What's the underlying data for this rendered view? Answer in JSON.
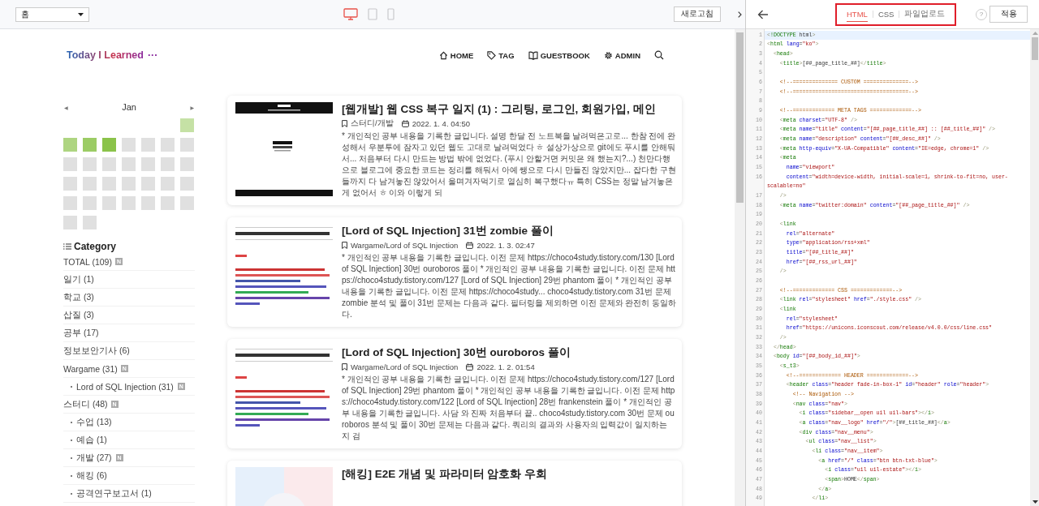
{
  "toolbar": {
    "page_select": "홈",
    "devices": [
      {
        "kind": "desktop",
        "selected": true
      },
      {
        "kind": "tablet",
        "selected": false
      },
      {
        "kind": "mobile",
        "selected": false
      }
    ],
    "refresh_button": "새로고침"
  },
  "blog": {
    "logo": "Today I Learned",
    "logo_more": "···",
    "nav": [
      {
        "kind": "home",
        "label": "HOME"
      },
      {
        "kind": "tag",
        "label": "TAG"
      },
      {
        "kind": "guestbook",
        "label": "GUESTBOOK"
      },
      {
        "kind": "admin",
        "label": "ADMIN"
      },
      {
        "kind": "search"
      }
    ]
  },
  "calendar": {
    "prev": "◀",
    "month": "Jan",
    "next": "▶",
    "days": [
      {
        "kind": "blank"
      },
      {
        "kind": "blank"
      },
      {
        "kind": "blank"
      },
      {
        "kind": "blank"
      },
      {
        "kind": "blank"
      },
      {
        "kind": "blank"
      },
      {
        "kind": "day",
        "color": "#c5e1a5"
      },
      {
        "kind": "day",
        "color": "#aed581"
      },
      {
        "kind": "day",
        "color": "#9ccc65"
      },
      {
        "kind": "day",
        "color": "#8bc34a"
      },
      {
        "kind": "day",
        "color": "#e0e0e0"
      },
      {
        "kind": "day",
        "color": "#e0e0e0"
      },
      {
        "kind": "day",
        "color": "#e0e0e0"
      },
      {
        "kind": "day",
        "color": "#e0e0e0"
      },
      {
        "kind": "day",
        "color": "#e0e0e0"
      },
      {
        "kind": "day",
        "color": "#e0e0e0"
      },
      {
        "kind": "day",
        "color": "#e0e0e0"
      },
      {
        "kind": "day",
        "color": "#e0e0e0"
      },
      {
        "kind": "day",
        "color": "#e0e0e0"
      },
      {
        "kind": "day",
        "color": "#e0e0e0"
      },
      {
        "kind": "day",
        "color": "#e0e0e0"
      },
      {
        "kind": "day",
        "color": "#e0e0e0"
      },
      {
        "kind": "day",
        "color": "#e0e0e0"
      },
      {
        "kind": "day",
        "color": "#e0e0e0"
      },
      {
        "kind": "day",
        "color": "#e0e0e0"
      },
      {
        "kind": "day",
        "color": "#e0e0e0"
      },
      {
        "kind": "day",
        "color": "#e0e0e0"
      },
      {
        "kind": "day",
        "color": "#e0e0e0"
      },
      {
        "kind": "day",
        "color": "#e0e0e0"
      },
      {
        "kind": "day",
        "color": "#e0e0e0"
      },
      {
        "kind": "day",
        "color": "#e0e0e0"
      },
      {
        "kind": "day",
        "color": "#e0e0e0"
      },
      {
        "kind": "day",
        "color": "#e0e0e0"
      },
      {
        "kind": "day",
        "color": "#e0e0e0"
      },
      {
        "kind": "day",
        "color": "#e0e0e0"
      },
      {
        "kind": "day",
        "color": "#e0e0e0"
      },
      {
        "kind": "day",
        "color": "#e0e0e0"
      }
    ]
  },
  "category": {
    "title": "Category",
    "items": [
      {
        "label": "TOTAL (109)",
        "badge": "N"
      },
      {
        "label": "일기 (1)"
      },
      {
        "label": "학교 (3)"
      },
      {
        "label": "삽질 (3)"
      },
      {
        "label": "공부 (17)"
      },
      {
        "label": "정보보안기사 (6)"
      },
      {
        "label": "Wargame (31)",
        "badge": "N",
        "children": [
          {
            "label": "Lord of SQL Injection (31)",
            "badge": "N"
          }
        ]
      },
      {
        "label": "스터디 (48)",
        "badge": "N",
        "children": [
          {
            "label": "수업 (13)"
          },
          {
            "label": "예습 (1)"
          },
          {
            "label": "개발 (27)",
            "badge": "N"
          },
          {
            "label": "해킹 (6)"
          },
          {
            "label": "공격연구보고서 (1)"
          }
        ]
      }
    ]
  },
  "posts": [
    {
      "title": "[웹개발] 웹 CSS 복구 일지 (1) : 그리팅, 로그인, 회원가입, 메인",
      "category": "스터디/개발",
      "date": "2022. 1. 4. 04:50",
      "excerpt": "* 개인적인 공부 내용을 기록한 글입니다. 설명 한달 전 노트북을 날려먹은고로... 한참 전에 완성해서 우분투에 잠자고 있던 웹도 고대로 날려먹었다 ㅎ 설상가상으로 git에도 푸시를 안해둬서... 처음부터 다시 만드는 방법 밖에 없었다. (푸시 안할거면 커밋은 왜 했는지?...) 천만다행으로 블로그에 중요한 코드는 정리를 해둬서 아예 쌩으로 다시 만들진 않았지만... 잡다한 구현들까지 다 남겨놓진 않았어서 울며겨자먹기로 열심히 복구했다ㅠ 특히 CSS는 정말 남겨놓은게 없어서 ㅎ 이와 이렇게 되"
    },
    {
      "title": "[Lord of SQL Injection] 31번 zombie 풀이",
      "category": "Wargame/Lord of SQL Injection",
      "date": "2022. 1. 3. 02:47",
      "excerpt": "* 개인적인 공부 내용을 기록한 글입니다. 이전 문제 https://choco4study.tistory.com/130 [Lord of SQL Injection] 30번 ouroboros 풀이 * 개인적인 공부 내용을 기록한 글입니다. 이전 문제 https://choco4study.tistory.com/127 [Lord of SQL Injection] 29번 phantom 풀이 * 개인적인 공부 내용을 기록한 글입니다. 이전 문제 https://choco4study... choco4study.tistory.com 31번 문제 zombie 분석 및 풀이 31번 문제는 다음과 같다. 필터링을 제외하면 이전 문제와 완전히 동일하다."
    },
    {
      "title": "[Lord of SQL Injection] 30번 ouroboros 풀이",
      "category": "Wargame/Lord of SQL Injection",
      "date": "2022. 1. 2. 01:54",
      "excerpt": "* 개인적인 공부 내용을 기록한 글입니다. 이전 문제 https://choco4study.tistory.com/127 [Lord of SQL Injection] 29번 phantom 풀이 * 개인적인 공부 내용을 기록한 글입니다. 이전 문제 https://choco4study.tistory.com/122 [Lord of SQL Injection] 28번 frankenstein 풀이 * 개인적인 공부 내용을 기록한 글입니다. 사담 와 진짜 처음부터 끝.. choco4study.tistory.com 30번 문제 ouroboros 분석 및 풀이 30번 문제는 다음과 같다. 쿼리의 결과와 사용자의 입력값이 일치하는 지 검"
    },
    {
      "title": "[해킹] E2E 개념 및 파라미터 암호화 우회"
    }
  ],
  "editor": {
    "tabs": [
      {
        "label": "HTML",
        "selected": true
      },
      {
        "label": "CSS",
        "selected": false
      },
      {
        "label": "파일업로드",
        "selected": false
      }
    ],
    "help": "?",
    "apply_button": "적용",
    "lines": [
      {
        "number": "1",
        "text": "<!DOCTYPE html>",
        "selected": true
      },
      {
        "number": "2",
        "text": "<html lang=\"ko\">",
        "selected": false
      },
      {
        "number": "3",
        "text": "  <head>",
        "selected": false
      },
      {
        "number": "4",
        "text": "    <title>[##_page_title_##]</title>",
        "selected": false
      },
      {
        "number": "5",
        "selected": false
      },
      {
        "number": "6",
        "text": "    <!--============== CUSTOM ==============-->",
        "selected": false
      },
      {
        "number": "7",
        "text": "    <!--====================================-->",
        "selected": false
      },
      {
        "number": "8",
        "selected": false
      },
      {
        "number": "9",
        "text": "    <!--============= META TAGS =============-->",
        "selected": false
      },
      {
        "number": "10",
        "text": "    <meta charset=\"UTF-8\" />",
        "selected": false
      },
      {
        "number": "11",
        "text": "    <meta name=\"title\" content=\"[##_page_title_##] :: [##_title_##]\" />",
        "selected": false
      },
      {
        "number": "12",
        "text": "    <meta name=\"description\" content=\"[##_desc_##]\" />",
        "selected": false
      },
      {
        "number": "13",
        "text": "    <meta http-equiv=\"X-UA-Compatible\" content=\"IE=edge, chrome=1\" />",
        "selected": false
      },
      {
        "number": "14",
        "text": "    <meta",
        "selected": false
      },
      {
        "number": "15",
        "text": "      name=\"viewport\"",
        "selected": false
      },
      {
        "number": "16",
        "text": "      content=\"width=device-width, initial-scale=1, shrink-to-fit=no, user-scalable=no\"",
        "selected": false
      },
      {
        "number": "17",
        "text": "    />",
        "selected": false
      },
      {
        "number": "18",
        "text": "    <meta name=\"twitter:domain\" content=\"[##_page_title_##]\" />",
        "selected": false
      },
      {
        "number": "19",
        "selected": false
      },
      {
        "number": "20",
        "text": "    <link",
        "selected": false
      },
      {
        "number": "21",
        "text": "      rel=\"alternate\"",
        "selected": false
      },
      {
        "number": "22",
        "text": "      type=\"application/rss+xml\"",
        "selected": false
      },
      {
        "number": "23",
        "text": "      title=\"[##_title_##]\"",
        "selected": false
      },
      {
        "number": "24",
        "text": "      href=\"[##_rss_url_##]\"",
        "selected": false
      },
      {
        "number": "25",
        "text": "    />",
        "selected": false
      },
      {
        "number": "26",
        "selected": false
      },
      {
        "number": "27",
        "text": "    <!--============= CSS =============-->",
        "selected": false
      },
      {
        "number": "28",
        "text": "    <link rel=\"stylesheet\" href=\"./style.css\" />",
        "selected": false
      },
      {
        "number": "29",
        "text": "    <link",
        "selected": false
      },
      {
        "number": "30",
        "text": "      rel=\"stylesheet\"",
        "selected": false
      },
      {
        "number": "31",
        "text": "      href=\"https://unicons.iconscout.com/release/v4.0.0/css/line.css\"",
        "selected": false
      },
      {
        "number": "32",
        "text": "    />",
        "selected": false
      },
      {
        "number": "33",
        "text": "  </head>",
        "selected": false
      },
      {
        "number": "34",
        "text": "  <body id=\"[##_body_id_##]\">",
        "selected": false
      },
      {
        "number": "35",
        "text": "    <s_t3>",
        "selected": false
      },
      {
        "number": "36",
        "text": "      <!--============= HEADER =============-->",
        "selected": false
      },
      {
        "number": "37",
        "text": "      <header class=\"header fade-in-box-1\" id=\"header\" role=\"header\">",
        "selected": false
      },
      {
        "number": "38",
        "text": "        <!-- Navigation -->",
        "selected": false
      },
      {
        "number": "39",
        "text": "        <nav class=\"nav\">",
        "selected": false
      },
      {
        "number": "40",
        "text": "          <i class=\"sidebar__open uil uil-bars\"></i>",
        "selected": false
      },
      {
        "number": "41",
        "text": "          <a class=\"nav__logo\" href=\"/\">[##_title_##]</a>",
        "selected": false
      },
      {
        "number": "42",
        "text": "          <div class=\"nav__menu\">",
        "selected": false
      },
      {
        "number": "43",
        "text": "            <ul class=\"nav__list\">",
        "selected": false
      },
      {
        "number": "44",
        "text": "              <li class=\"nav__item\">",
        "selected": false
      },
      {
        "number": "45",
        "text": "                <a href=\"/\" class=\"btn btn-txt-blue\">",
        "selected": false
      },
      {
        "number": "46",
        "text": "                  <i class=\"uil uil-estate\"></i>",
        "selected": false
      },
      {
        "number": "47",
        "text": "                  <span>HOME</span>",
        "selected": false
      },
      {
        "number": "48",
        "text": "                </a>",
        "selected": false
      },
      {
        "number": "49",
        "text": "              </li>",
        "selected": false
      }
    ]
  }
}
